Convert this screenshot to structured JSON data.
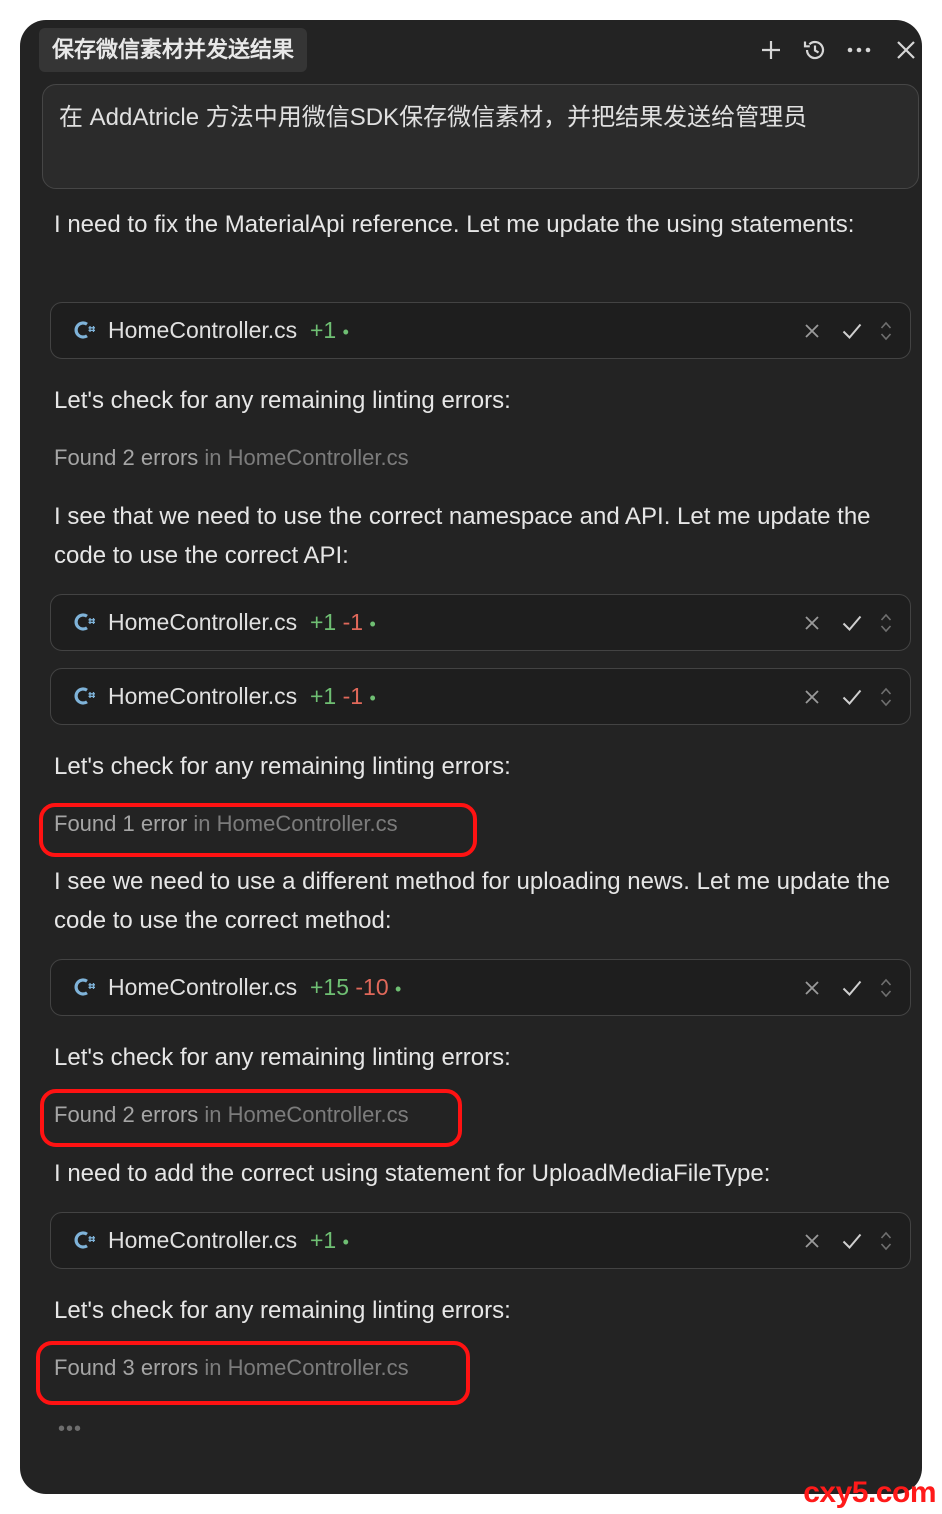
{
  "header": {
    "title": "保存微信素材并发送结果",
    "icons": [
      "plus-icon",
      "history-icon",
      "more-icon",
      "close-icon"
    ]
  },
  "prompt": {
    "text": "在 AddAtricle 方法中用微信SDK保存微信素材，并把结果发送给管理员"
  },
  "messages": [
    "I need to fix the MaterialApi reference. Let me update the using statements:",
    "Let's check for any remaining linting errors:",
    "I see that we need to use the correct namespace and API. Let me update the code to use the correct API:",
    "Let's check for any remaining linting errors:",
    "I see we need to use a different method for uploading news. Let me update the code to use the correct method:",
    "Let's check for any remaining linting errors:",
    "I need to add the correct using statement for UploadMediaFileType:",
    "Let's check for any remaining linting errors:"
  ],
  "files": [
    {
      "name": "HomeController.cs",
      "added": "+1",
      "removed": "",
      "dot": "•"
    },
    {
      "name": "HomeController.cs",
      "added": "+1",
      "removed": "-1",
      "dot": "•"
    },
    {
      "name": "HomeController.cs",
      "added": "+1",
      "removed": "-1",
      "dot": "•"
    },
    {
      "name": "HomeController.cs",
      "added": "+15",
      "removed": "-10",
      "dot": "•"
    },
    {
      "name": "HomeController.cs",
      "added": "+1",
      "removed": "",
      "dot": "•"
    }
  ],
  "lint_results": [
    {
      "found": "Found 2 errors",
      "where": "in HomeController.cs"
    },
    {
      "found": "Found 1 error",
      "where": "in HomeController.cs"
    },
    {
      "found": "Found 2 errors",
      "where": "in HomeController.cs"
    },
    {
      "found": "Found 3 errors",
      "where": "in HomeController.cs"
    }
  ],
  "ellipsis": "•••",
  "watermark": "cxy5.com",
  "colors": {
    "panel_bg": "#232323",
    "added": "#6fbf73",
    "removed": "#e0685a",
    "highlight": "#ff1212"
  }
}
